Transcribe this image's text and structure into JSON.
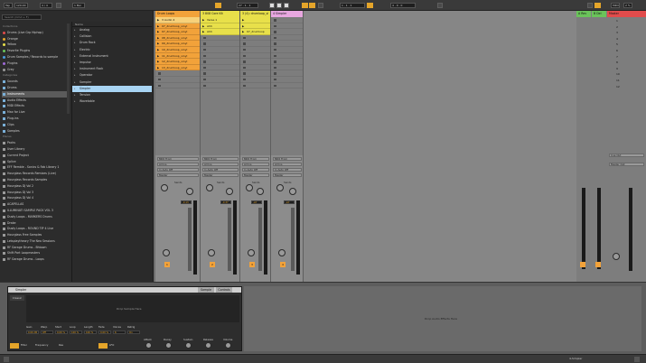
{
  "topbar": {
    "tap_label": "Tap",
    "tempo": "120.00",
    "time_sig": "4 / 4",
    "metronome_label": "1 Bar",
    "position": "27 . 1 . 1",
    "loop_start": "1 . 1 . 1",
    "loop_length": "4 . 0 . 0",
    "key_label": "KEY",
    "midi_label": "MIDI",
    "cpu_label": "2 %",
    "accent": "#e5a52a"
  },
  "browser": {
    "search_placeholder": "Search (Cmd + F)",
    "collections_head": "Collections",
    "collections": [
      {
        "label": "Drums (Live Grp Hiphop)",
        "color": "#e14c4c"
      },
      {
        "label": "Orange",
        "color": "#e5a52a"
      },
      {
        "label": "Yellow",
        "color": "#e8e04a"
      },
      {
        "label": "Favorite Plugins",
        "color": "#6ac35a"
      },
      {
        "label": "Drum Samples / Records to sample",
        "color": "#4a9de0"
      },
      {
        "label": "Plugins",
        "color": "#a06ad8"
      },
      {
        "label": "Grey",
        "color": "#9a9a9a"
      }
    ],
    "categories_head": "Categories",
    "categories": [
      "Sounds",
      "Drums",
      "Instruments",
      "Audio Effects",
      "MIDI Effects",
      "Max for Live",
      "Plug-ins",
      "Clips",
      "Samples"
    ],
    "places_head": "Places",
    "places": [
      "Packs",
      "User Library",
      "Current Project",
      "Splice",
      "EFF Remble - Sonics & Fab Library 1",
      "Hourglass Records Remixes (Live)",
      "Hourglass Records Samples",
      "Hourglass DJ Vol 2",
      "Hourglass DJ Vol 3",
      "Hourglass DJ Vol 4",
      "ACAPELLAS",
      "ILLUMINATI SAMPLE PACK VOL 3",
      "Dusty Loops - MARKERS Drums",
      "Drake",
      "Dusty Loops - ROUND TIP 4 Live",
      "Hourglass Free Samples",
      "Letsplaytheory The Neo Sessions",
      "RF Garage Drums - Bhtown",
      "Shift Part Loopmasters",
      "RF Garage Drums - Loops"
    ],
    "name_head": "Name",
    "names": [
      "Analog",
      "Collision",
      "Drum Rack",
      "Electric",
      "External Instrument",
      "Impulse",
      "Instrument Rack",
      "Operator",
      "Sampler",
      "Simpler",
      "Tension",
      "Wavetable"
    ],
    "selected_name": "Simpler"
  },
  "tracks": [
    {
      "name": "Drum Loops",
      "color": "#f2a23a",
      "clips": [
        "3 Audio 4",
        "07_drumloop_vinyl",
        "07_drumloop_vinyl",
        "08_drumloop_vinyl",
        "09_drumloop_vinyl",
        "10_drumloop_vinyl",
        "11_drumloop_vinyl",
        "12_drumloop_vinyl",
        "13_drumloop_vinyl"
      ],
      "num": "1"
    },
    {
      "name": "3 808 Core Kit",
      "color": "#e8e04a",
      "clips": [
        "Verse 1",
        "Ahh",
        "Ahh"
      ],
      "num": "2"
    },
    {
      "name": "3 (4): drumloop_vi",
      "color": "#e8e04a",
      "clips": [
        "",
        "",
        "07_drumloop"
      ],
      "num": "3"
    },
    {
      "name": "4 Simpler",
      "color": "#e8a7e0",
      "clips": [],
      "num": "4"
    }
  ],
  "returns": [
    {
      "name": "A Rev",
      "color": "#6ac35a"
    },
    {
      "name": "B Del",
      "color": "#6ac35a"
    }
  ],
  "master": {
    "name": "Master",
    "color": "#e14c4c",
    "scenes": [
      "1",
      "2",
      "3",
      "4",
      "5",
      "6",
      "7",
      "8",
      "9",
      "10",
      "11",
      "12"
    ]
  },
  "mixer": {
    "midi_from": "MIDI From",
    "all_ins": "All Ins",
    "all_channels": "All Channels",
    "monitor": "In  Auto  Off",
    "audio_to": "Master",
    "sends_label": "Sends",
    "vol_values": [
      "-0.13",
      "-0.37",
      "-inf",
      "-inf"
    ],
    "cue_out": "Cue Out",
    "master_out": "Master Out",
    "ii_label": "ii 1/2"
  },
  "device": {
    "title": "Simpler",
    "tabs": [
      "Sample",
      "Controls"
    ],
    "mode": "Classic",
    "drop_text": "Drop Sample Here",
    "params": [
      "Gain",
      "Warp",
      "Start",
      "Loop",
      "Length",
      "Fade",
      "Voices",
      "Retrig"
    ],
    "param_values": [
      "0.00 dB",
      "Off",
      "0.00 %",
      "100 %",
      "100 %",
      "0.00 %",
      "6",
      "On"
    ],
    "filter_label": "Filter",
    "lfo_label": "LFO",
    "env_labels": [
      "Attack",
      "Decay",
      "Sustain",
      "Release",
      "Volume"
    ],
    "freq_label": "Frequency",
    "res_label": "Res"
  },
  "detail_right": {
    "drop_text": "Drop Audio Effects Here"
  },
  "statusbar": {
    "left": "",
    "right": "4-Simpler"
  }
}
